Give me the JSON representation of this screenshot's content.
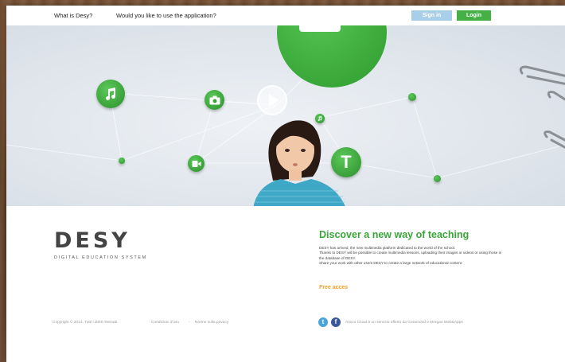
{
  "nav": {
    "link_what": "What is Desy?",
    "link_use": "Would you like to use the application?",
    "signin": "Sign in",
    "login": "Login"
  },
  "hero": {
    "node_text_icon": "T"
  },
  "logo": {
    "name": "DESY",
    "subtitle": "DIGITAL EDUCATION SYSTEM"
  },
  "intro": {
    "tagline": "Discover a new way of teaching",
    "description_1": "DESY has arrived, the new multimedia platform dedicated to the world of the school.",
    "description_2": "Thanks to DESY will be possible to create multimedia lessons, uploading their images or videos or using those in the database of DESY.",
    "description_3": "Share your work with other users DESY to create a large network of educational content.",
    "free_access": "Free acces"
  },
  "footer": {
    "copyright": "Copyright © 2013. Tutti i diritti riservati.",
    "terms": "Condizioni d'uso",
    "separator": "-",
    "privacy": "Norme sulla privacy",
    "credits": "Amico Cloud è un servizio offerto da Garamond e Morgan Web&Apps"
  },
  "colors": {
    "accent_green": "#3aa63a",
    "signin_blue": "#a9cfe8",
    "free_orange": "#f0a02a"
  }
}
